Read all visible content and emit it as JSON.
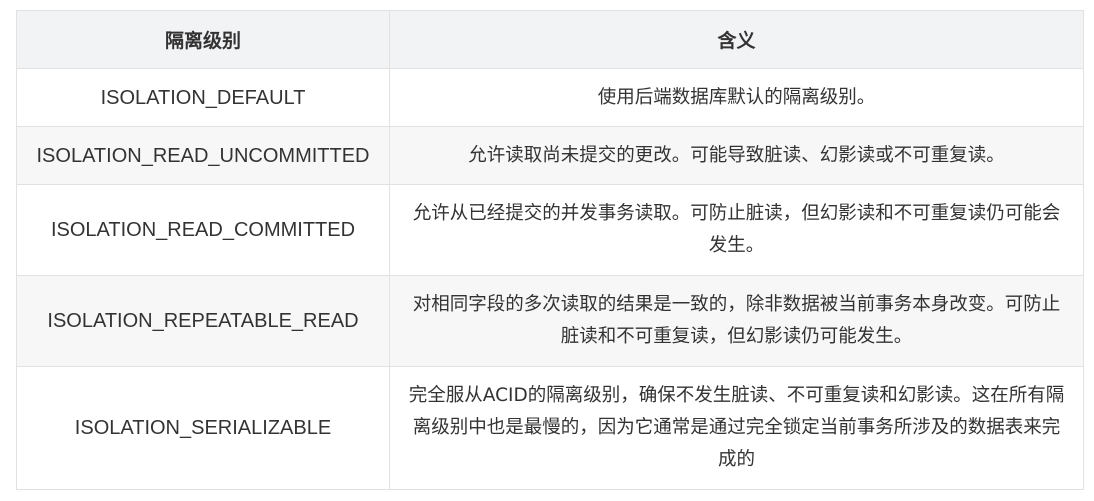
{
  "table": {
    "headers": [
      "隔离级别",
      "含义"
    ],
    "rows": [
      {
        "level": "ISOLATION_DEFAULT",
        "meaning": "使用后端数据库默认的隔离级别。"
      },
      {
        "level": "ISOLATION_READ_UNCOMMITTED",
        "meaning": "允许读取尚未提交的更改。可能导致脏读、幻影读或不可重复读。"
      },
      {
        "level": "ISOLATION_READ_COMMITTED",
        "meaning": "允许从已经提交的并发事务读取。可防止脏读，但幻影读和不可重复读仍可能会发生。"
      },
      {
        "level": "ISOLATION_REPEATABLE_READ",
        "meaning": "对相同字段的多次读取的结果是一致的，除非数据被当前事务本身改变。可防止脏读和不可重复读，但幻影读仍可能发生。"
      },
      {
        "level": "ISOLATION_SERIALIZABLE",
        "meaning": "完全服从ACID的隔离级别，确保不发生脏读、不可重复读和幻影读。这在所有隔离级别中也是最慢的，因为它通常是通过完全锁定当前事务所涉及的数据表来完成的"
      }
    ]
  }
}
